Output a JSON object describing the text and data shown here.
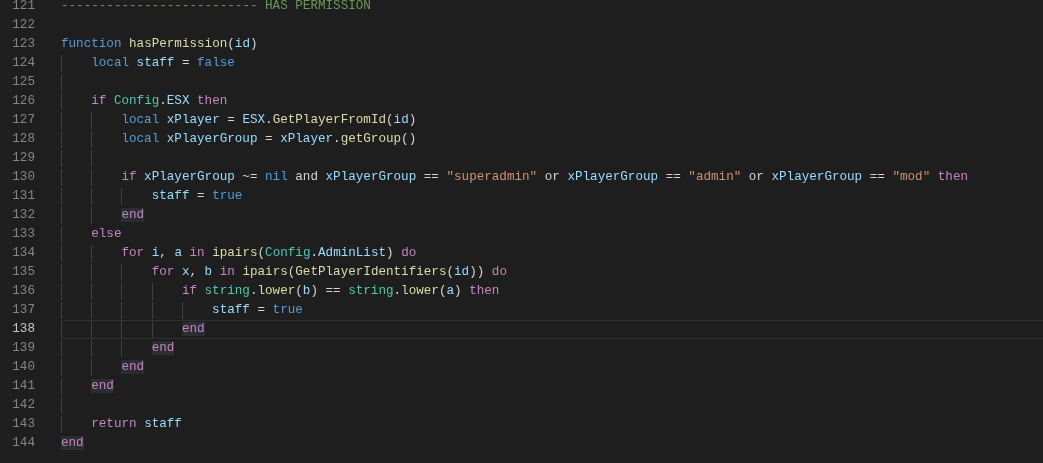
{
  "editor": {
    "lines": [
      {
        "number": "121",
        "current": false,
        "tokens": [
          {
            "kind": "comment",
            "text": "-------------------------- HAS PERMISSION"
          }
        ]
      },
      {
        "number": "122",
        "current": false
      },
      {
        "number": "123",
        "current": false,
        "tokens": [
          {
            "kind": "storage",
            "text": "function"
          },
          {
            "kind": "function",
            "text": " hasPermission"
          },
          {
            "kind": "plain",
            "text": "("
          },
          {
            "kind": "variable",
            "text": "id"
          },
          {
            "kind": "plain",
            "text": ")"
          }
        ],
        "children": [
          {
            "number": "124",
            "current": false,
            "tokens": [
              {
                "kind": "storage",
                "text": "local"
              },
              {
                "kind": "variable",
                "text": " staff"
              },
              {
                "kind": "plain",
                "text": " = "
              },
              {
                "kind": "constant",
                "text": "false"
              }
            ]
          },
          {
            "number": "125",
            "current": false
          },
          {
            "number": "126",
            "current": false,
            "tokens": [
              {
                "kind": "keyword",
                "text": "if"
              },
              {
                "kind": "class",
                "text": " Config"
              },
              {
                "kind": "plain",
                "text": "."
              },
              {
                "kind": "variable",
                "text": "ESX"
              },
              {
                "kind": "keyword",
                "text": " then"
              }
            ],
            "children": [
              {
                "number": "127",
                "current": false,
                "tokens": [
                  {
                    "kind": "storage",
                    "text": "local"
                  },
                  {
                    "kind": "variable",
                    "text": " xPlayer"
                  },
                  {
                    "kind": "plain",
                    "text": " = "
                  },
                  {
                    "kind": "variable",
                    "text": "ESX"
                  },
                  {
                    "kind": "plain",
                    "text": "."
                  },
                  {
                    "kind": "function",
                    "text": "GetPlayerFromId"
                  },
                  {
                    "kind": "plain",
                    "text": "("
                  },
                  {
                    "kind": "variable",
                    "text": "id"
                  },
                  {
                    "kind": "plain",
                    "text": ")"
                  }
                ]
              },
              {
                "number": "128",
                "current": false,
                "tokens": [
                  {
                    "kind": "storage",
                    "text": "local"
                  },
                  {
                    "kind": "variable",
                    "text": " xPlayerGroup"
                  },
                  {
                    "kind": "plain",
                    "text": " = "
                  },
                  {
                    "kind": "variable",
                    "text": "xPlayer"
                  },
                  {
                    "kind": "plain",
                    "text": "."
                  },
                  {
                    "kind": "function",
                    "text": "getGroup"
                  },
                  {
                    "kind": "plain",
                    "text": "()"
                  }
                ]
              },
              {
                "number": "129",
                "current": false
              },
              {
                "number": "130",
                "current": false,
                "tokens": [
                  {
                    "kind": "keyword",
                    "text": "if"
                  },
                  {
                    "kind": "variable",
                    "text": " xPlayerGroup"
                  },
                  {
                    "kind": "plain",
                    "text": " ~= "
                  },
                  {
                    "kind": "constant",
                    "text": "nil"
                  },
                  {
                    "kind": "plain",
                    "text": " and "
                  },
                  {
                    "kind": "variable",
                    "text": "xPlayerGroup"
                  },
                  {
                    "kind": "plain",
                    "text": " == "
                  },
                  {
                    "kind": "string",
                    "text": "\"superadmin\""
                  },
                  {
                    "kind": "plain",
                    "text": " or "
                  },
                  {
                    "kind": "variable",
                    "text": "xPlayerGroup"
                  },
                  {
                    "kind": "plain",
                    "text": " == "
                  },
                  {
                    "kind": "string",
                    "text": "\"admin\""
                  },
                  {
                    "kind": "plain",
                    "text": " or "
                  },
                  {
                    "kind": "variable",
                    "text": "xPlayerGroup"
                  },
                  {
                    "kind": "plain",
                    "text": " == "
                  },
                  {
                    "kind": "string",
                    "text": "\"mod\""
                  },
                  {
                    "kind": "keyword",
                    "text": " then"
                  }
                ],
                "children": [
                  {
                    "number": "131",
                    "current": false,
                    "tokens": [
                      {
                        "kind": "variable",
                        "text": "staff"
                      },
                      {
                        "kind": "plain",
                        "text": " = "
                      },
                      {
                        "kind": "constant",
                        "text": "true"
                      }
                    ]
                  }
                ]
              },
              {
                "number": "132",
                "current": false,
                "tokens": [
                  {
                    "kind": "matched",
                    "text": "end"
                  }
                ]
              }
            ]
          },
          {
            "number": "133",
            "current": false,
            "tokens": [
              {
                "kind": "keyword",
                "text": "else"
              }
            ],
            "children": [
              {
                "number": "134",
                "current": false,
                "tokens": [
                  {
                    "kind": "keyword",
                    "text": "for"
                  },
                  {
                    "kind": "variable",
                    "text": " i"
                  },
                  {
                    "kind": "plain",
                    "text": ", "
                  },
                  {
                    "kind": "variable",
                    "text": "a"
                  },
                  {
                    "kind": "keyword",
                    "text": " in"
                  },
                  {
                    "kind": "function",
                    "text": " ipairs"
                  },
                  {
                    "kind": "plain",
                    "text": "("
                  },
                  {
                    "kind": "class",
                    "text": "Config"
                  },
                  {
                    "kind": "plain",
                    "text": "."
                  },
                  {
                    "kind": "variable",
                    "text": "AdminList"
                  },
                  {
                    "kind": "plain",
                    "text": ")"
                  },
                  {
                    "kind": "keyword",
                    "text": " do"
                  }
                ],
                "children": [
                  {
                    "number": "135",
                    "current": false,
                    "tokens": [
                      {
                        "kind": "keyword",
                        "text": "for"
                      },
                      {
                        "kind": "variable",
                        "text": " x"
                      },
                      {
                        "kind": "plain",
                        "text": ", "
                      },
                      {
                        "kind": "variable",
                        "text": "b"
                      },
                      {
                        "kind": "keyword",
                        "text": " in"
                      },
                      {
                        "kind": "function",
                        "text": " ipairs"
                      },
                      {
                        "kind": "plain",
                        "text": "("
                      },
                      {
                        "kind": "function",
                        "text": "GetPlayerIdentifiers"
                      },
                      {
                        "kind": "plain",
                        "text": "("
                      },
                      {
                        "kind": "variable",
                        "text": "id"
                      },
                      {
                        "kind": "plain",
                        "text": "))"
                      },
                      {
                        "kind": "keyword",
                        "text": " do"
                      }
                    ],
                    "children": [
                      {
                        "number": "136",
                        "current": false,
                        "tokens": [
                          {
                            "kind": "keyword",
                            "text": "if"
                          },
                          {
                            "kind": "class",
                            "text": " string"
                          },
                          {
                            "kind": "plain",
                            "text": "."
                          },
                          {
                            "kind": "function",
                            "text": "lower"
                          },
                          {
                            "kind": "plain",
                            "text": "("
                          },
                          {
                            "kind": "variable",
                            "text": "b"
                          },
                          {
                            "kind": "plain",
                            "text": ") == "
                          },
                          {
                            "kind": "class",
                            "text": "string"
                          },
                          {
                            "kind": "plain",
                            "text": "."
                          },
                          {
                            "kind": "function",
                            "text": "lower"
                          },
                          {
                            "kind": "plain",
                            "text": "("
                          },
                          {
                            "kind": "variable",
                            "text": "a"
                          },
                          {
                            "kind": "plain",
                            "text": ")"
                          },
                          {
                            "kind": "keyword",
                            "text": " then"
                          }
                        ],
                        "children": [
                          {
                            "number": "137",
                            "current": false,
                            "tokens": [
                              {
                                "kind": "variable",
                                "text": "staff"
                              },
                              {
                                "kind": "plain",
                                "text": " = "
                              },
                              {
                                "kind": "constant",
                                "text": "true"
                              }
                            ]
                          }
                        ]
                      },
                      {
                        "number": "138",
                        "current": true,
                        "tokens": [
                          {
                            "kind": "matched",
                            "text": "end"
                          }
                        ]
                      }
                    ]
                  },
                  {
                    "number": "139",
                    "current": false,
                    "tokens": [
                      {
                        "kind": "matched",
                        "text": "end"
                      }
                    ]
                  }
                ]
              },
              {
                "number": "140",
                "current": false,
                "tokens": [
                  {
                    "kind": "matched",
                    "text": "end"
                  }
                ]
              }
            ]
          },
          {
            "number": "141",
            "current": false,
            "tokens": [
              {
                "kind": "matched",
                "text": "end"
              }
            ]
          },
          {
            "number": "142",
            "current": false
          },
          {
            "number": "143",
            "current": false,
            "tokens": [
              {
                "kind": "keyword",
                "text": "return"
              },
              {
                "kind": "variable",
                "text": " staff"
              }
            ]
          }
        ]
      },
      {
        "number": "144",
        "current": false,
        "tokens": [
          {
            "kind": "matched",
            "text": "end"
          }
        ]
      }
    ]
  }
}
